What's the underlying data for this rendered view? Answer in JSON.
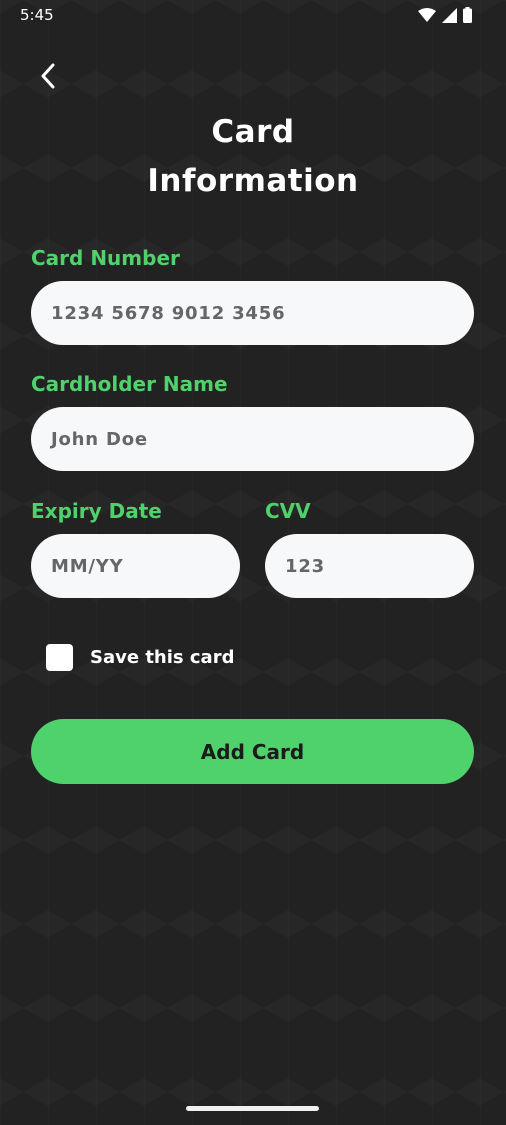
{
  "status_bar": {
    "time": "5:45",
    "icons": [
      "wifi-icon",
      "signal-icon",
      "battery-icon"
    ]
  },
  "header": {
    "back_icon": "chevron-left-icon",
    "title_line1": "Card",
    "title_line2": "Information"
  },
  "form": {
    "card_number": {
      "label": "Card Number",
      "placeholder": "1234 5678 9012 3456",
      "value": ""
    },
    "cardholder_name": {
      "label": "Cardholder Name",
      "placeholder": "John Doe",
      "value": ""
    },
    "expiry_date": {
      "label": "Expiry Date",
      "placeholder": "MM/YY",
      "value": ""
    },
    "cvv": {
      "label": "CVV",
      "placeholder": "123",
      "value": ""
    },
    "save_card": {
      "label": "Save this card",
      "checked": false
    },
    "submit_label": "Add Card"
  },
  "colors": {
    "accent": "#4fd16b",
    "background": "#222222",
    "field_bg": "#f7f8fa"
  }
}
